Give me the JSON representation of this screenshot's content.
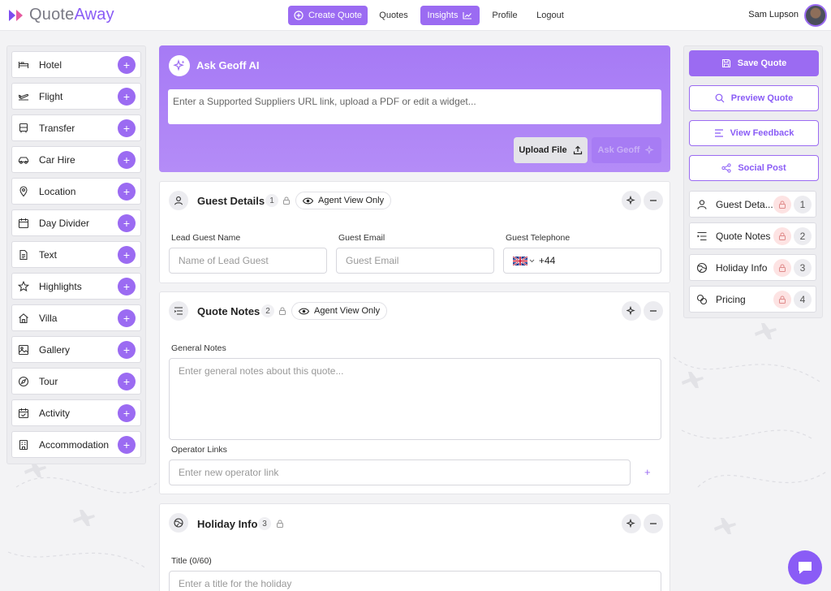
{
  "app": {
    "logo_prefix": "Quote",
    "logo_suffix": "Away"
  },
  "nav": {
    "create_quote": "Create Quote",
    "quotes": "Quotes",
    "insights": "Insights",
    "profile": "Profile",
    "logout": "Logout",
    "user_name": "Sam Lupson"
  },
  "widgets": [
    {
      "label": "Hotel",
      "icon": "bed-icon"
    },
    {
      "label": "Flight",
      "icon": "plane-icon"
    },
    {
      "label": "Transfer",
      "icon": "bus-icon"
    },
    {
      "label": "Car Hire",
      "icon": "car-icon"
    },
    {
      "label": "Location",
      "icon": "map-pin-icon"
    },
    {
      "label": "Day Divider",
      "icon": "calendar-icon"
    },
    {
      "label": "Text",
      "icon": "document-icon"
    },
    {
      "label": "Highlights",
      "icon": "star-icon"
    },
    {
      "label": "Villa",
      "icon": "house-icon"
    },
    {
      "label": "Gallery",
      "icon": "image-icon"
    },
    {
      "label": "Tour",
      "icon": "compass-icon"
    },
    {
      "label": "Activity",
      "icon": "calendar-check-icon"
    },
    {
      "label": "Accommodation",
      "icon": "building-icon"
    }
  ],
  "ask_geoff": {
    "title": "Ask Geoff AI",
    "placeholder": "Enter a Supported Suppliers URL link, upload a PDF or edit a widget...",
    "upload_label": "Upload File",
    "ask_label": "Ask Geoff"
  },
  "guest_details": {
    "title": "Guest Details",
    "number": "1",
    "agent_view": "Agent View Only",
    "lead_label": "Lead Guest Name",
    "lead_placeholder": "Name of Lead Guest",
    "email_label": "Guest Email",
    "email_placeholder": "Guest Email",
    "phone_label": "Guest Telephone",
    "phone_value": "+44"
  },
  "quote_notes": {
    "title": "Quote Notes",
    "number": "2",
    "agent_view": "Agent View Only",
    "general_label": "General Notes",
    "general_placeholder": "Enter general notes about this quote...",
    "operator_label": "Operator Links",
    "operator_placeholder": "Enter new operator link"
  },
  "holiday_info": {
    "title": "Holiday Info",
    "number": "3",
    "title_label": "Title (0/60)",
    "title_placeholder": "Enter a title for the holiday"
  },
  "right_actions": {
    "save": "Save Quote",
    "preview": "Preview Quote",
    "feedback": "View Feedback",
    "social": "Social Post"
  },
  "sections": [
    {
      "label": "Guest Deta...",
      "number": "1",
      "icon": "person-icon"
    },
    {
      "label": "Quote Notes",
      "number": "2",
      "icon": "list-icon"
    },
    {
      "label": "Holiday Info",
      "number": "3",
      "icon": "globe-icon"
    },
    {
      "label": "Pricing",
      "number": "4",
      "icon": "coins-icon"
    }
  ],
  "colors": {
    "accent": "#9b6bf2",
    "accent_dark": "#8a5cf6"
  }
}
